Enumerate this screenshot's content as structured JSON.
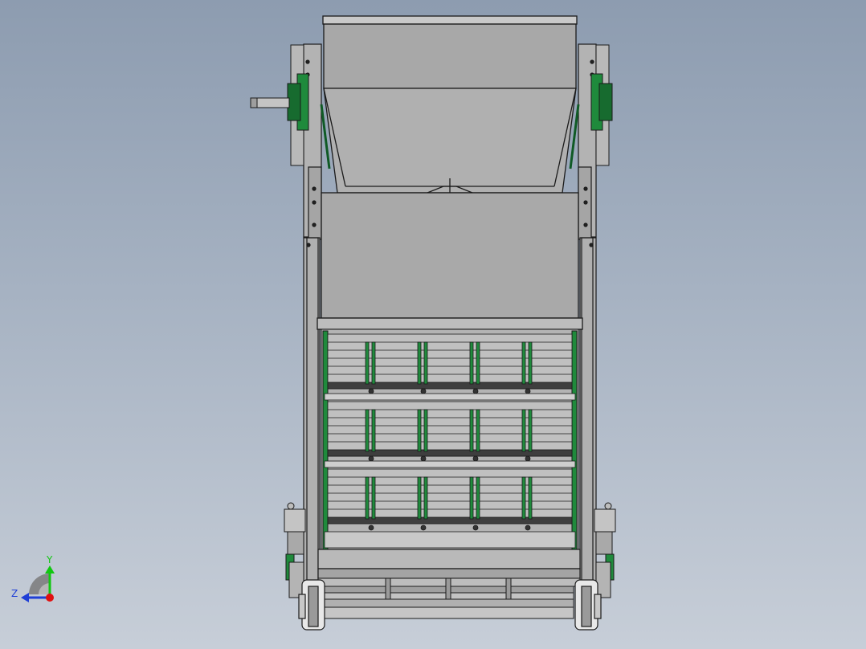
{
  "viewport": {
    "background_top": "#8d9cb0",
    "background_bottom": "#c7ced8"
  },
  "colors": {
    "metal_light": "#b9b9b9",
    "metal_mid": "#a9a9a9",
    "metal_dark": "#8e8e8e",
    "edge": "#1a1a1a",
    "green_part": "#1f8a3c",
    "green_dark": "#0f5a25"
  },
  "triad": {
    "y_label": "Y",
    "z_label": "Z",
    "y_color": "#11c711",
    "z_color": "#1f3fd6",
    "origin_color": "#e01010"
  },
  "sieve": {
    "screen_decks": 3,
    "dividers_per_deck": 4
  }
}
